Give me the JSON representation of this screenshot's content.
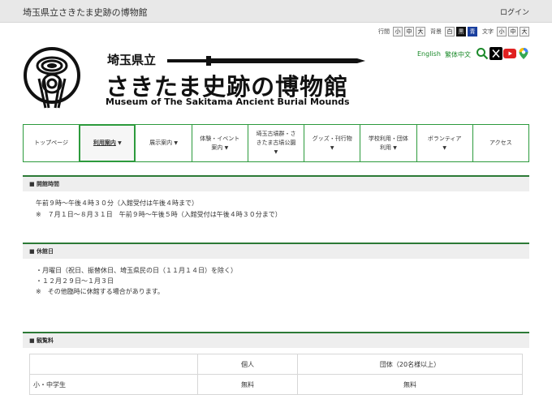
{
  "topbar": {
    "title": "埼玉県立さきたま史跡の博物館",
    "login": "ログイン"
  },
  "accessibility": {
    "spacing_label": "行間",
    "bg_label": "背景",
    "text_label": "文字",
    "sizes": [
      "小",
      "中",
      "大"
    ],
    "bg_options": [
      "白",
      "黒",
      "青"
    ]
  },
  "brand": {
    "prefecture": "埼玉県立",
    "name": "さきたま史跡の博物館",
    "english": "Museum of The Sakitama Ancient Burial Mounds"
  },
  "languages": [
    "English",
    "繁体中文"
  ],
  "social_icons": [
    "search-icon",
    "x-icon",
    "youtube-icon",
    "map-pin-icon"
  ],
  "nav": {
    "items": [
      {
        "lines": [
          "トップページ"
        ],
        "caret": ""
      },
      {
        "lines": [
          "利用案内"
        ],
        "caret": "▼"
      },
      {
        "lines": [
          "展示案内"
        ],
        "caret": "▼"
      },
      {
        "lines": [
          "体験・イベント",
          "案内"
        ],
        "caret": "▼"
      },
      {
        "lines": [
          "埼玉古墳群・さ",
          "きたま古墳公園"
        ],
        "caret": "▼"
      },
      {
        "lines": [
          "グッズ・刊行物"
        ],
        "caret": "▼"
      },
      {
        "lines": [
          "学校利用・団体",
          "利用"
        ],
        "caret": "▼"
      },
      {
        "lines": [
          "ボランティア"
        ],
        "caret": "▼"
      },
      {
        "lines": [
          "アクセス"
        ],
        "caret": ""
      }
    ]
  },
  "hours": {
    "title": "■ 開館時間",
    "line1": "午前９時～午後４時３０分（入館受付は午後４時まで）",
    "line2": "※　７月１日～８月３１日　午前９時～午後５時（入館受付は午後４時３０分まで）"
  },
  "closed": {
    "title": "■ 休館日",
    "line1": "・月曜日（祝日、振替休日、埼玉県民の日（１１月１４日）を除く）",
    "line2": "・１２月２９日～１月３日",
    "line3": "※　その他臨時に休館する場合があります。"
  },
  "fees": {
    "title": "■ 観覧料",
    "headers": [
      "",
      "個人",
      "団体（20名様以上）"
    ],
    "rows": [
      {
        "label": "小・中学生",
        "individual": "無料",
        "group": "無料"
      }
    ]
  },
  "colors": {
    "nav_green": "#2c9a3c",
    "section_green": "#2c7a36",
    "link_green": "#1b8a2a",
    "bg_blue": "#1a3f9e"
  }
}
